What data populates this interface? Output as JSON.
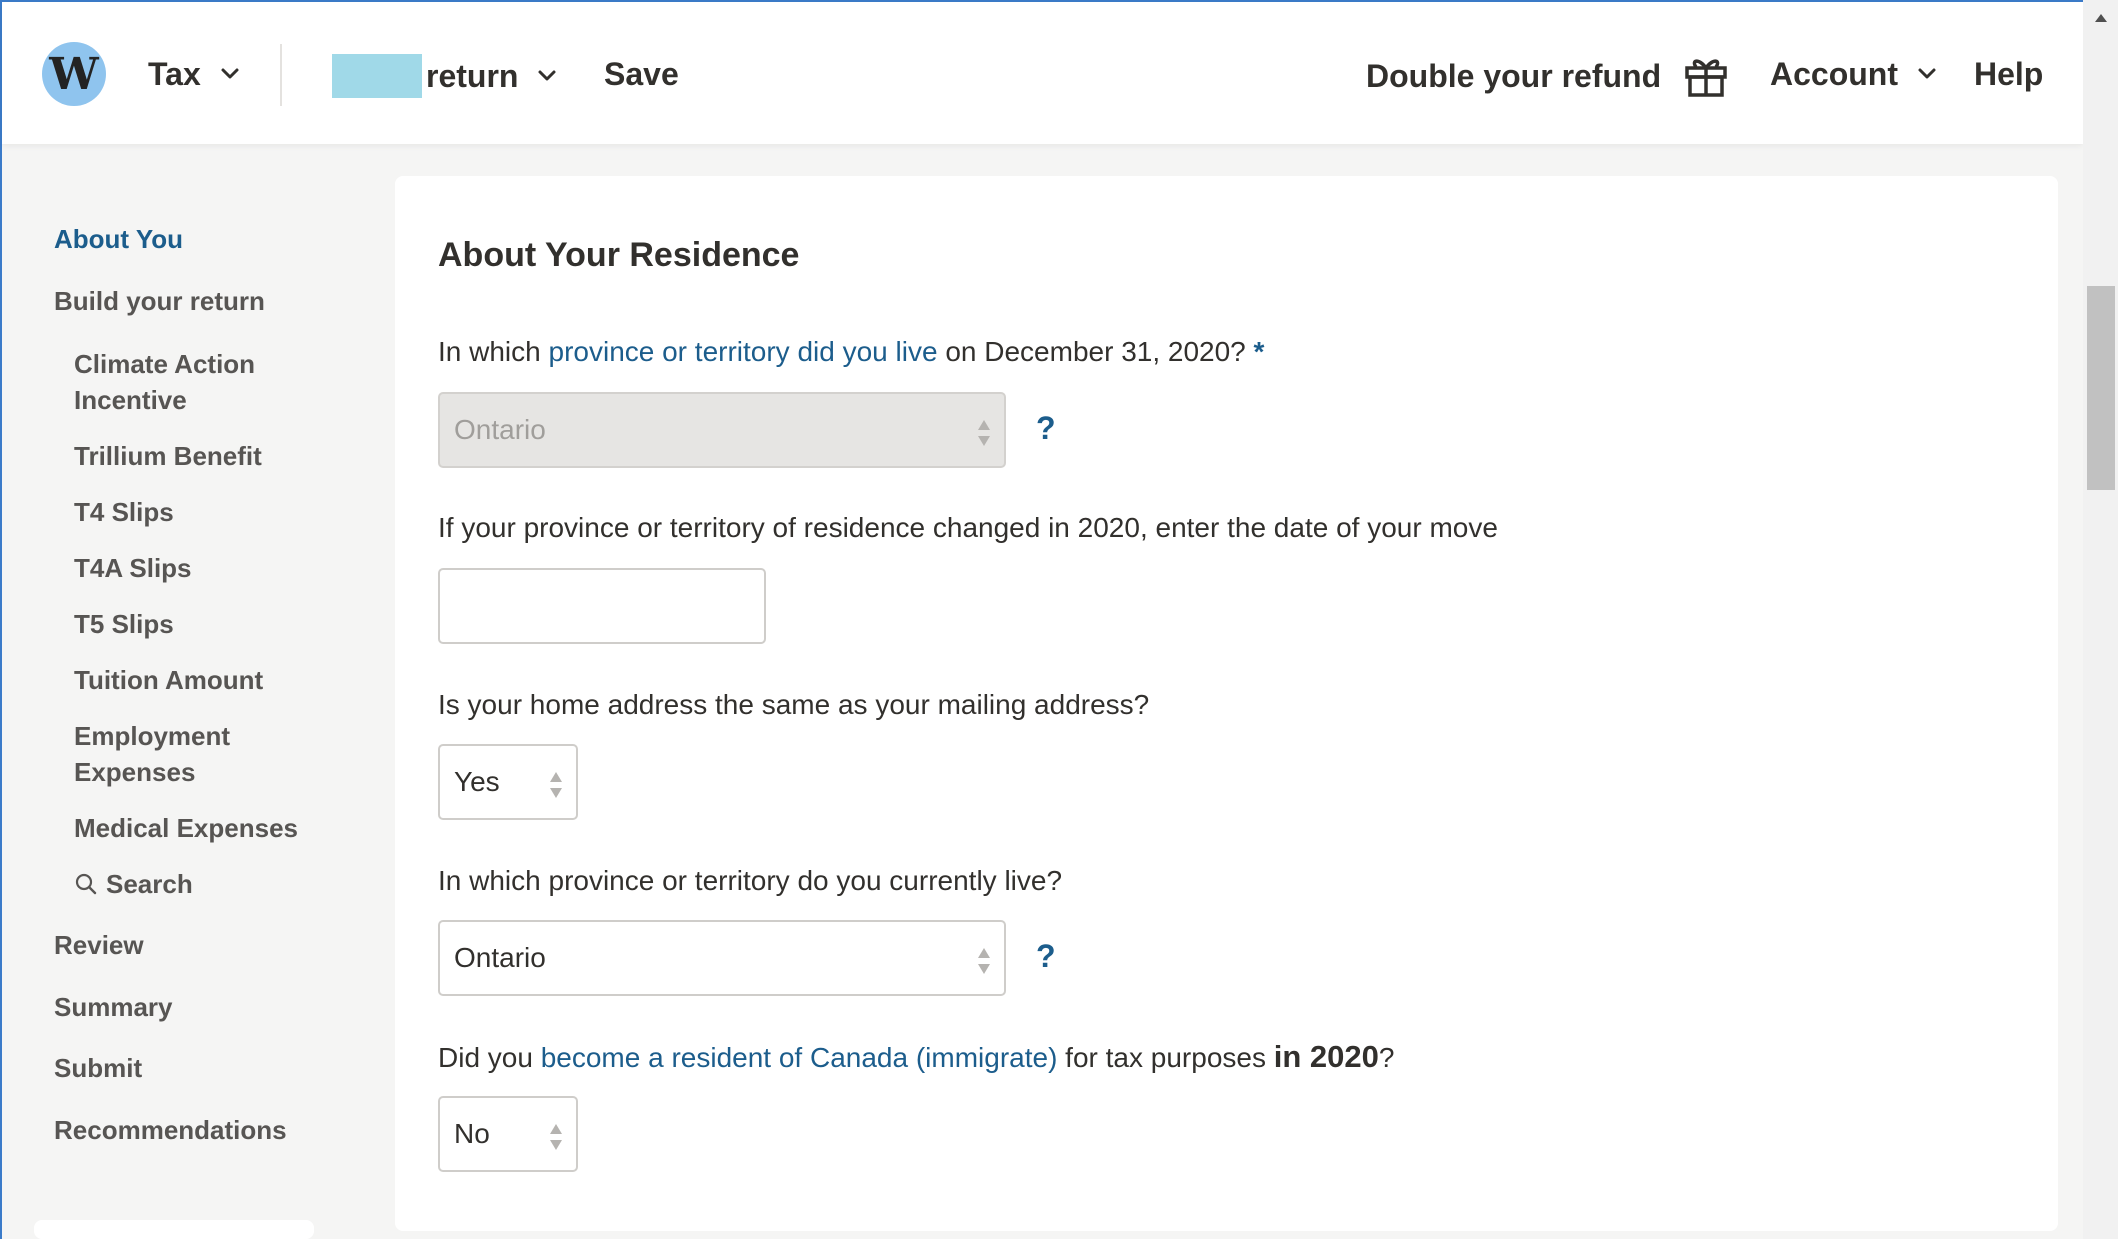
{
  "header": {
    "logo_letter": "W",
    "product_menu_label": "Tax",
    "return_menu_label": "return",
    "save_label": "Save",
    "refund_label": "Double your refund",
    "account_label": "Account",
    "help_label": "Help"
  },
  "sidebar": {
    "about_you": "About You",
    "build_return": "Build your return",
    "sub_items": [
      "Climate Action Incentive",
      "Trillium Benefit",
      "T4 Slips",
      "T4A Slips",
      "T5 Slips",
      "Tuition Amount",
      "Employment Expenses",
      "Medical Expenses"
    ],
    "search_label": "Search",
    "review": "Review",
    "summary": "Summary",
    "submit": "Submit",
    "recommendations": "Recommendations"
  },
  "form": {
    "section_title": "About Your Residence",
    "q1": {
      "prefix": "In which ",
      "link": "province or territory did you live",
      "suffix": " on December 31, 2020?",
      "required_mark": "*",
      "value": "Ontario",
      "help": "?"
    },
    "q2": {
      "text": "If your province or territory of residence changed in 2020, enter the date of your move",
      "value": ""
    },
    "q3": {
      "text": "Is your home address the same as your mailing address?",
      "value": "Yes"
    },
    "q4": {
      "text": "In which province or territory do you currently live?",
      "value": "Ontario",
      "help": "?"
    },
    "q5": {
      "prefix": "Did you ",
      "link": "become a resident of Canada (immigrate)",
      "middle": " for tax purposes ",
      "strong": "in 2020",
      "suffix": "?",
      "value": "No"
    }
  },
  "colors": {
    "accent": "#1c5d8c",
    "logo_bg": "#8fc4ee",
    "frame": "#3b7bc9"
  }
}
